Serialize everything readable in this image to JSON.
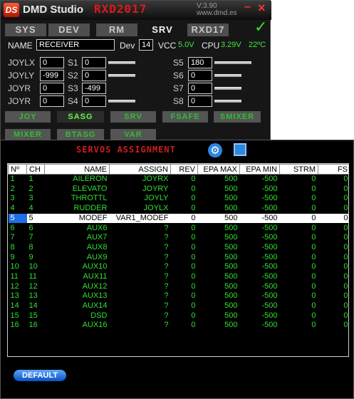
{
  "app": {
    "title": "DMD Studio",
    "tag": "RXD2017",
    "version": "V:3.90",
    "site": "www.dmd.es",
    "minimize": "–",
    "close": "×",
    "ok_symbol": "✓"
  },
  "tabs": [
    "SYS",
    "DEV",
    "RM",
    "SRV",
    "RXD17"
  ],
  "active_tab": "SRV",
  "info": {
    "name_label": "NAME",
    "name_value": "RECEIVER",
    "dev_label": "Dev",
    "dev_value": "14",
    "vcc_label": "VCC",
    "vcc_value": "5.0V",
    "cpu_label": "CPU",
    "cpu_value": "3.29V",
    "temp": "22ºC"
  },
  "joys": [
    {
      "label": "JOYLX",
      "value": "0"
    },
    {
      "label": "JOYLY",
      "value": "-999"
    },
    {
      "label": "JOYR",
      "value": "0"
    },
    {
      "label": "JOYR",
      "value": "0"
    }
  ],
  "servos_left": [
    {
      "label": "S1",
      "value": "0"
    },
    {
      "label": "S2",
      "value": "0"
    },
    {
      "label": "S3",
      "value": "-499"
    },
    {
      "label": "S4",
      "value": "0"
    }
  ],
  "servos_right": [
    {
      "label": "S5",
      "value": "180"
    },
    {
      "label": "S6",
      "value": "0"
    },
    {
      "label": "S7",
      "value": "0"
    },
    {
      "label": "S8",
      "value": "0"
    }
  ],
  "subnav_row1": [
    "JOY",
    "SASG",
    "SRV",
    "FSAFE",
    "SMIXER"
  ],
  "subnav_row2": [
    "MIXER",
    "BTASG",
    "VAR"
  ],
  "active_subnav": "SASG",
  "section_title": "SERVOS ASSIGNMENT",
  "columns": [
    "Nº",
    "CH",
    "NAME",
    "ASSIGN",
    "REV",
    "EPA MAX",
    "EPA MIN",
    "STRM",
    "FS"
  ],
  "rows": [
    [
      "1",
      "1",
      "AILERON",
      "JOYRX",
      "0",
      "500",
      "-500",
      "0",
      "0"
    ],
    [
      "2",
      "2",
      "ELEVATO",
      "JOYRY",
      "0",
      "500",
      "-500",
      "0",
      "0"
    ],
    [
      "3",
      "3",
      "THROTTL",
      "JOYLY",
      "0",
      "500",
      "-500",
      "0",
      "0"
    ],
    [
      "4",
      "4",
      "RUDDER",
      "JOYLX",
      "0",
      "500",
      "-500",
      "0",
      "0"
    ],
    [
      "5",
      "5",
      "MODEF",
      "VAR1_MODEF",
      "0",
      "500",
      "-500",
      "0",
      "0"
    ],
    [
      "6",
      "6",
      "AUX6",
      "?",
      "0",
      "500",
      "-500",
      "0",
      "0"
    ],
    [
      "7",
      "7",
      "AUX7",
      "?",
      "0",
      "500",
      "-500",
      "0",
      "0"
    ],
    [
      "8",
      "8",
      "AUX8",
      "?",
      "0",
      "500",
      "-500",
      "0",
      "0"
    ],
    [
      "9",
      "9",
      "AUX9",
      "?",
      "0",
      "500",
      "-500",
      "0",
      "0"
    ],
    [
      "10",
      "10",
      "AUX10",
      "?",
      "0",
      "500",
      "-500",
      "0",
      "0"
    ],
    [
      "11",
      "11",
      "AUX11",
      "?",
      "0",
      "500",
      "-500",
      "0",
      "0"
    ],
    [
      "12",
      "12",
      "AUX12",
      "?",
      "0",
      "500",
      "-500",
      "0",
      "0"
    ],
    [
      "13",
      "13",
      "AUX13",
      "?",
      "0",
      "500",
      "-500",
      "0",
      "0"
    ],
    [
      "14",
      "14",
      "AUX14",
      "?",
      "0",
      "500",
      "-500",
      "0",
      "0"
    ],
    [
      "15",
      "15",
      "DSD",
      "?",
      "0",
      "500",
      "-500",
      "0",
      "0"
    ],
    [
      "16",
      "16",
      "AUX16",
      "?",
      "0",
      "500",
      "-500",
      "0",
      "0"
    ]
  ],
  "selected_row": 5,
  "default_button": "DEFAULT"
}
